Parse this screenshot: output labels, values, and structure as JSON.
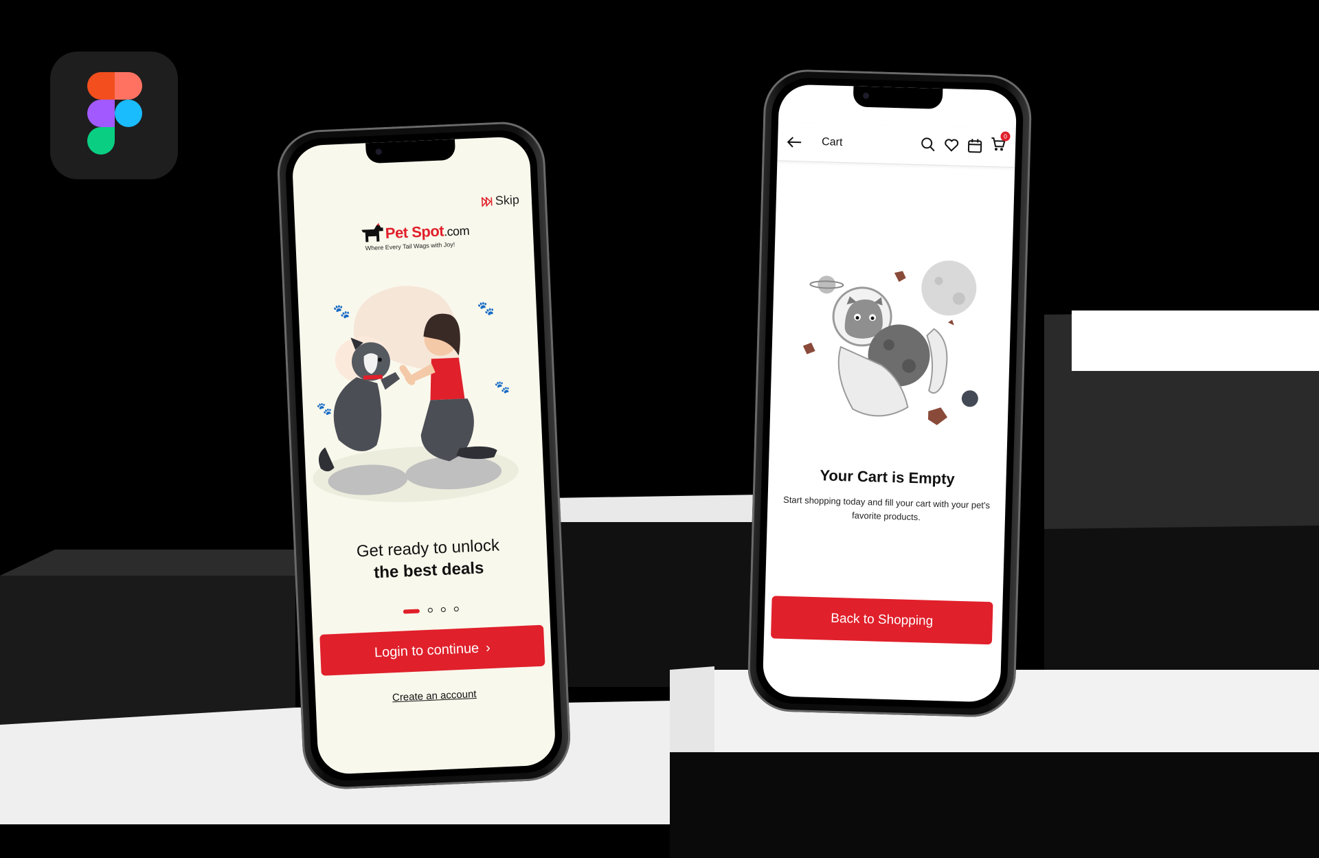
{
  "screen1": {
    "skip_label": "Skip",
    "brand_name_red": "Pet Spot",
    "brand_name_suffix": ".com",
    "tagline": "Where Every Tail Wags with Joy!",
    "headline_line1": "Get ready to unlock",
    "headline_line2": "the best deals",
    "login_button": "Login to continue",
    "login_chevron": "›",
    "create_account": "Create an account",
    "pagination": {
      "total": 4,
      "active": 1
    }
  },
  "screen2": {
    "title": "Cart",
    "cart_badge_count": "0",
    "empty_title": "Your Cart is Empty",
    "empty_description": "Start shopping today and fill your cart with your pet's favorite products.",
    "back_button": "Back to Shopping"
  },
  "colors": {
    "accent_red": "#e0202b",
    "screen1_bg": "#f9f8ec",
    "screen2_bg": "#ffffff"
  },
  "icons": [
    "figma-logo-icon",
    "skip-icon",
    "dog-logo-icon",
    "back-arrow-icon",
    "search-icon",
    "heart-icon",
    "calendar-icon",
    "cart-icon"
  ]
}
